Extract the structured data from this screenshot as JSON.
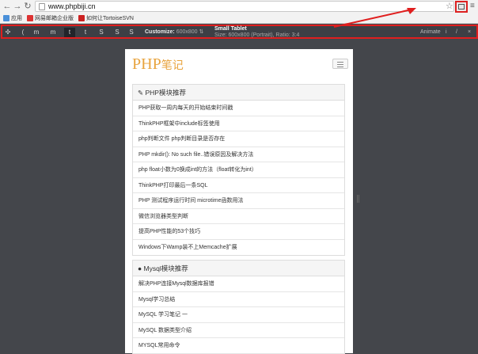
{
  "browser": {
    "url": "www.phpbiji.cn",
    "bookmarks": [
      {
        "label": "应用",
        "color": "#4a90d9"
      },
      {
        "label": "网易邮箱企业版",
        "color": "#d33"
      },
      {
        "label": "如何让TortoiseSVN",
        "color": "#c22"
      }
    ]
  },
  "toolbar": {
    "customize_label": "Customize:",
    "customize_value": "600x800",
    "device_name": "Small Tablet",
    "device_size": "Size: 600x800 (Portrait), Ratio: 3:4",
    "animate_label": "Animate",
    "device_buttons": [
      "(",
      "m",
      "m",
      "t",
      "t",
      "S",
      "S",
      "S"
    ],
    "accent": "#e01e1e"
  },
  "site": {
    "logo_text": "PHP",
    "logo_cn": "笔记",
    "panels": [
      {
        "title": "PHP模块推荐",
        "items": [
          "PHP获取一周内每天的开始结束时间戳",
          "ThinkPHP框架中include标签使用",
          "php判断文件 php判断目录是否存在",
          "PHP mkdir(): No such file..错误原因及解决方法",
          "php float小数为0换成int的方法（float转化为int）",
          "ThinkPHP打印最后一条SQL",
          "PHP 测试程序运行时间 microtime函数用法",
          "微信浏览器类型判断",
          "提高PHP性能的53个技巧",
          "Windows下Wamp装不上Memcache扩展"
        ]
      },
      {
        "title": "Mysql模块推荐",
        "items": [
          "解决PHP连接Mysql数据库报错",
          "Mysql学习总结",
          "MySQL 学习笔记 一",
          "MySQL 数据类型介绍",
          "MYSQL常用命令"
        ]
      }
    ]
  }
}
